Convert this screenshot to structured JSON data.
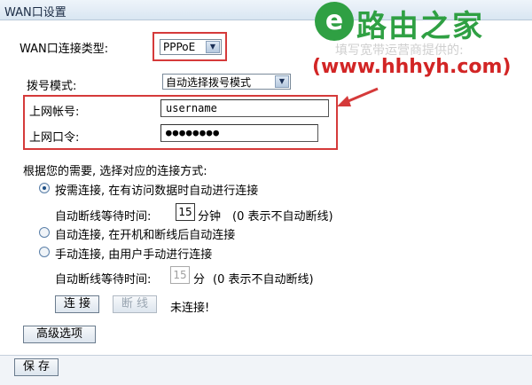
{
  "header": {
    "title": "WAN口设置"
  },
  "watermark": {
    "logo_char": "e",
    "brand": "路由之家",
    "faint": "填写宽带运营商提供的:",
    "url": "(www.hhhyh.com)"
  },
  "connection_type": {
    "label": "WAN口连接类型:",
    "value": "PPPoE"
  },
  "dial_mode": {
    "label": "拨号模式:",
    "value": "自动选择拨号模式"
  },
  "account": {
    "label": "上网帐号:",
    "value": "username"
  },
  "password": {
    "label": "上网口令:",
    "value": "●●●●●●●●"
  },
  "modes": {
    "heading": "根据您的需要, 选择对应的连接方式:",
    "on_demand": "按需连接, 在有访问数据时自动进行连接",
    "wait1_label": "自动断线等待时间:",
    "wait1_value": "15",
    "wait1_unit": "分钟",
    "wait1_hint": "(0 表示不自动断线)",
    "auto": "自动连接, 在开机和断线后自动连接",
    "manual": "手动连接, 由用户手动进行连接",
    "wait2_label": "自动断线等待时间:",
    "wait2_value": "15",
    "wait2_unit": "分",
    "wait2_hint": "(0 表示不自动断线)"
  },
  "actions": {
    "connect": "连 接",
    "disconnect": "断 线",
    "status": "未连接!",
    "advanced": "高级选项",
    "save": "保 存"
  },
  "colors": {
    "highlight": "#d53a3a",
    "brand": "#2fa043",
    "title_bg": "#d9e6f2"
  }
}
